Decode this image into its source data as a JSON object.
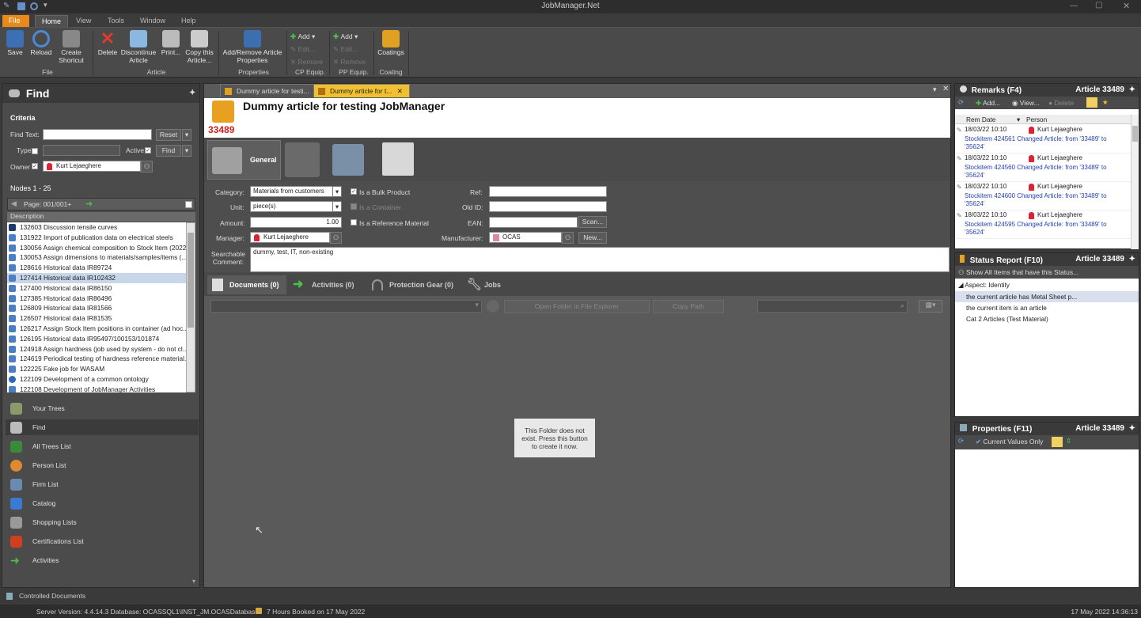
{
  "window": {
    "title": "JobManager.Net"
  },
  "menu": {
    "file": "File",
    "home": "Home",
    "view": "View",
    "tools": "Tools",
    "window": "Window",
    "help": "Help"
  },
  "ribbon": {
    "save": "Save",
    "reload": "Reload",
    "create_shortcut": "Create Shortcut",
    "file_group": "File",
    "delete": "Delete",
    "discontinue": "Discontinue Article",
    "print": "Print...",
    "copy_article": "Copy this Article...",
    "article_group": "Article",
    "add_remove_props": "Add/Remove Article Properties",
    "properties_group": "Properties",
    "cp_add": "Add",
    "cp_edit": "Edit...",
    "cp_remove": "Remove",
    "cp_group": "CP Equip.",
    "pp_add": "Add",
    "pp_edit": "Edit...",
    "pp_remove": "Remove",
    "pp_group": "PP Equip.",
    "coatings": "Coatings",
    "coating_group": "Coating",
    "colors": {
      "file_tab": "#e88a1a",
      "active_doc_tab": "#f0c030"
    }
  },
  "find": {
    "title": "Find",
    "criteria_label": "Criteria",
    "find_text_label": "Find Text:",
    "find_text_value": "",
    "reset": "Reset",
    "type_label": "Type",
    "active_label": "Active",
    "active_checked": "✓",
    "find_button": "Find",
    "owner_label": "Owner",
    "owner_checked": "✓",
    "owner_value": "Kurt Lejaeghere",
    "nodes_label": "Nodes 1 - 25",
    "page_label": "Page: 001/001+",
    "column_header": "Description",
    "items": [
      "132603 Discussion tensile curves",
      "131922 Import of publication data on electrical steels",
      "130056 Assign chemical composition to Stock Item (2022)",
      "130053 Assign dimensions to materials/samples/items (...",
      "128616 Historical data IR89724",
      "127414 Historical data IR102432",
      "127400 Historical data IR86150",
      "127385 Historical data IR86496",
      "126809 Historical data IR81566",
      "126507 Historical data IR81535",
      "126217 Assign Stock Item positions in container (ad hoc...",
      "126195 Historical data IR95497/100153/101874",
      "124918 Assign hardness (job used by system - do not cl...",
      "124619 Periodical testing of hardness reference material...",
      "122225 Fake job for WASAM",
      "122109 Development of a common ontology",
      "122108 Development of JobManager Activities"
    ]
  },
  "nav": {
    "your_trees": "Your Trees",
    "find": "Find",
    "all_trees": "All Trees List",
    "person_list": "Person List",
    "firm_list": "Firm List",
    "catalog": "Catalog",
    "shopping_lists": "Shopping Lists",
    "certifications": "Certifications List",
    "activities": "Activities"
  },
  "tabs": {
    "tab1": "Dummy article for testi...",
    "tab2": "Dummy article for t..."
  },
  "article": {
    "title": "Dummy article for testing JobManager",
    "number": "33489",
    "subtab_general": "General",
    "category_label": "Category:",
    "category_value": "Materials from customers",
    "bulk_label": "Is a Bulk Product",
    "bulk_checked": "✓",
    "ref_label": "Ref:",
    "unit_label": "Unit:",
    "unit_value": "piece(s)",
    "container_label": "Is a Container",
    "oldid_label": "Old ID:",
    "amount_label": "Amount:",
    "amount_value": "1.00",
    "reference_label": "Is a Reference Material",
    "ean_label": "EAN:",
    "scan": "Scan...",
    "manager_label": "Manager:",
    "manager_value": "Kurt Lejaeghere",
    "manufacturer_label": "Manufacturer:",
    "manufacturer_value": "OCAS",
    "new_button": "New...",
    "comment_label": "Searchable Comment:",
    "comment_value": "dummy, test, IT, non-existing"
  },
  "doc_tabs": {
    "documents": "Documents (0)",
    "activities": "Activities (0)",
    "protection": "Protection Gear (0)",
    "jobs": "Jobs"
  },
  "doc_toolbar": {
    "open_folder": "Open Folder in File Explorer",
    "copy_path": "Copy Path"
  },
  "folder_message": "This Folder does not exist. Press this button to create it now.",
  "remarks": {
    "title": "Remarks (F4)",
    "article": "Article 33489",
    "add": "Add...",
    "view": "View...",
    "delete": "Delete",
    "col_date": "Rem Date",
    "col_person": "Person",
    "items": [
      {
        "date": "18/03/22 10:10",
        "person": "Kurt Lejaeghere",
        "text": "Stockitem 424561 Changed Article: from '33489' to '35624'"
      },
      {
        "date": "18/03/22 10:10",
        "person": "Kurt Lejaeghere",
        "text": "Stockitem 424560 Changed Article: from '33489' to '35624'"
      },
      {
        "date": "18/03/22 10:10",
        "person": "Kurt Lejaeghere",
        "text": "Stockitem 424600 Changed Article: from '33489' to '35624'"
      },
      {
        "date": "18/03/22 10:10",
        "person": "Kurt Lejaeghere",
        "text": "Stockitem 424595 Changed Article: from '33489' to '35624'"
      }
    ]
  },
  "status_report": {
    "title": "Status Report (F10)",
    "article": "Article 33489",
    "show_all": "Show All Items that have this Status...",
    "aspect": "Aspect: Identity",
    "items": [
      "the current article has Metal Sheet p...",
      "the current item is an article",
      "Cat 2 Articles (Test Material)"
    ]
  },
  "properties": {
    "title": "Properties (F11)",
    "article": "Article 33489",
    "current_values": "Current Values Only"
  },
  "controlled_documents": "Controlled Documents",
  "status_bar": {
    "server": "Server Version: 4.4.14.3 Database: OCASSQL1\\INST_JM.OCASDatabase",
    "booked": "7 Hours Booked on 17 May 2022",
    "datetime": "17 May 2022 14:36:13"
  }
}
